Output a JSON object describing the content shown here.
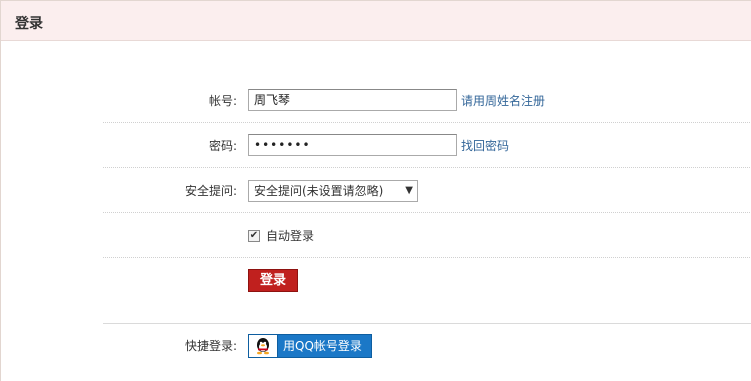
{
  "title": "登录",
  "form": {
    "account_label": "帐号:",
    "account_value": "周飞琴",
    "register_link": "请用周姓名注册",
    "password_label": "密码:",
    "password_value": "•••••••",
    "recover_link": "找回密码",
    "security_label": "安全提问:",
    "security_selected": "安全提问(未设置请忽略)",
    "auto_login_label": "自动登录",
    "auto_login_checked": true,
    "login_button": "登录",
    "quick_login_label": "快捷登录:",
    "qq_button": "用QQ帐号登录"
  },
  "icons": {
    "dropdown": "chevron-down-icon",
    "qq": "qq-penguin-icon"
  },
  "colors": {
    "title_bg": "#fbeeee",
    "login_button": "#c0201e",
    "qq_button": "#1b78c7",
    "link": "#336699"
  }
}
